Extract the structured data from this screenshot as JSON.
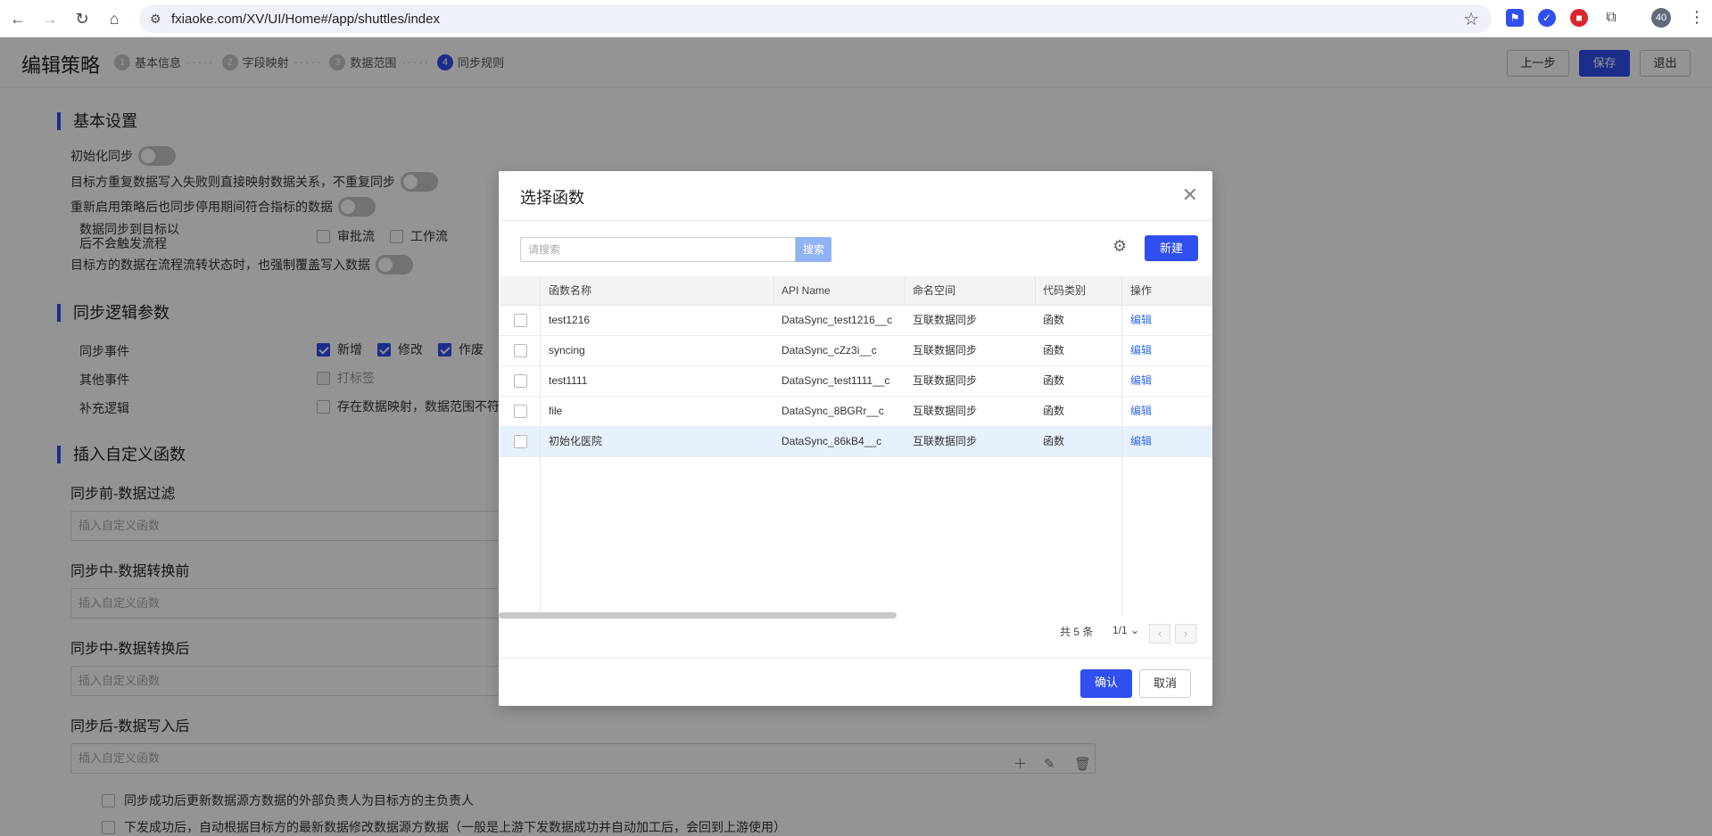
{
  "browser": {
    "url": "fxiaoke.com/XV/UI/Home#/app/shuttles/index",
    "profile_badge": "40",
    "icons": [
      "back-icon",
      "forward-icon",
      "reload-icon",
      "home-icon",
      "site-info-icon",
      "bookmark-star-icon",
      "extensions-icon",
      "menu-icon"
    ]
  },
  "header": {
    "title": "编辑策略",
    "steps": [
      {
        "num": "1",
        "label": "基本信息"
      },
      {
        "num": "2",
        "label": "字段映射"
      },
      {
        "num": "3",
        "label": "数据范围"
      },
      {
        "num": "4",
        "label": "同步规则"
      }
    ],
    "buttons": {
      "prev": "上一步",
      "save": "保存",
      "exit": "退出"
    }
  },
  "basic_settings": {
    "title": "基本设置",
    "init_sync": "初始化同步",
    "repeat_fail": "目标方重复数据写入失败则直接映射数据关系，不重复同步",
    "restart_sync": "重新启用策略后也同步停用期间符合指标的数据",
    "no_trigger_line1": "数据同步到目标以",
    "no_trigger_line2": "后不会触发流程",
    "approval_flow": "审批流",
    "work_flow": "工作流",
    "force_overwrite": "目标方的数据在流程流转状态时，也强制覆盖写入数据"
  },
  "sync_logic": {
    "title": "同步逻辑参数",
    "sync_events_label": "同步事件",
    "events": [
      "新增",
      "修改",
      "作废"
    ],
    "other_events_label": "其他事件",
    "tag": "打标签",
    "supplement_label": "补充逻辑",
    "supplement_text": "存在数据映射，数据范围不符"
  },
  "custom_functions": {
    "title": "插入自定义函数",
    "fields": [
      {
        "label": "同步前-数据过滤",
        "placeholder": "插入自定义函数"
      },
      {
        "label": "同步中-数据转换前",
        "placeholder": "插入自定义函数"
      },
      {
        "label": "同步中-数据转换后",
        "placeholder": "插入自定义函数"
      },
      {
        "label": "同步后-数据写入后",
        "placeholder": "插入自定义函数"
      }
    ],
    "bottom_options": [
      "同步成功后更新数据源方数据的外部负责人为目标方的主负责人",
      "下发成功后，自动根据目标方的最新数据修改数据源方数据（一般是上游下发数据成功并自动加工后，会回到上游使用）"
    ]
  },
  "modal": {
    "title": "选择函数",
    "search_placeholder": "请搜索",
    "search_btn": "搜索",
    "new_btn": "新建",
    "columns": [
      "函数名称",
      "API Name",
      "命名空间",
      "代码类别",
      "操作"
    ],
    "rows": [
      {
        "name": "test1216",
        "api": "DataSync_test1216__c",
        "ns": "互联数据同步",
        "type": "函数",
        "op": "编辑"
      },
      {
        "name": "syncing",
        "api": "DataSync_cZz3i__c",
        "ns": "互联数据同步",
        "type": "函数",
        "op": "编辑"
      },
      {
        "name": "test1111",
        "api": "DataSync_test1111__c",
        "ns": "互联数据同步",
        "type": "函数",
        "op": "编辑"
      },
      {
        "name": "file",
        "api": "DataSync_8BGRr__c",
        "ns": "互联数据同步",
        "type": "函数",
        "op": "编辑"
      },
      {
        "name": "初始化医院",
        "api": "DataSync_86kB4__c",
        "ns": "互联数据同步",
        "type": "函数",
        "op": "编辑"
      }
    ],
    "total": "共 5 条",
    "page": "1/1",
    "confirm": "确认",
    "cancel": "取消"
  },
  "colors": {
    "primary": "#2f4ff0",
    "link": "#2f6ae8",
    "selected_row": "#e7f1fd"
  }
}
